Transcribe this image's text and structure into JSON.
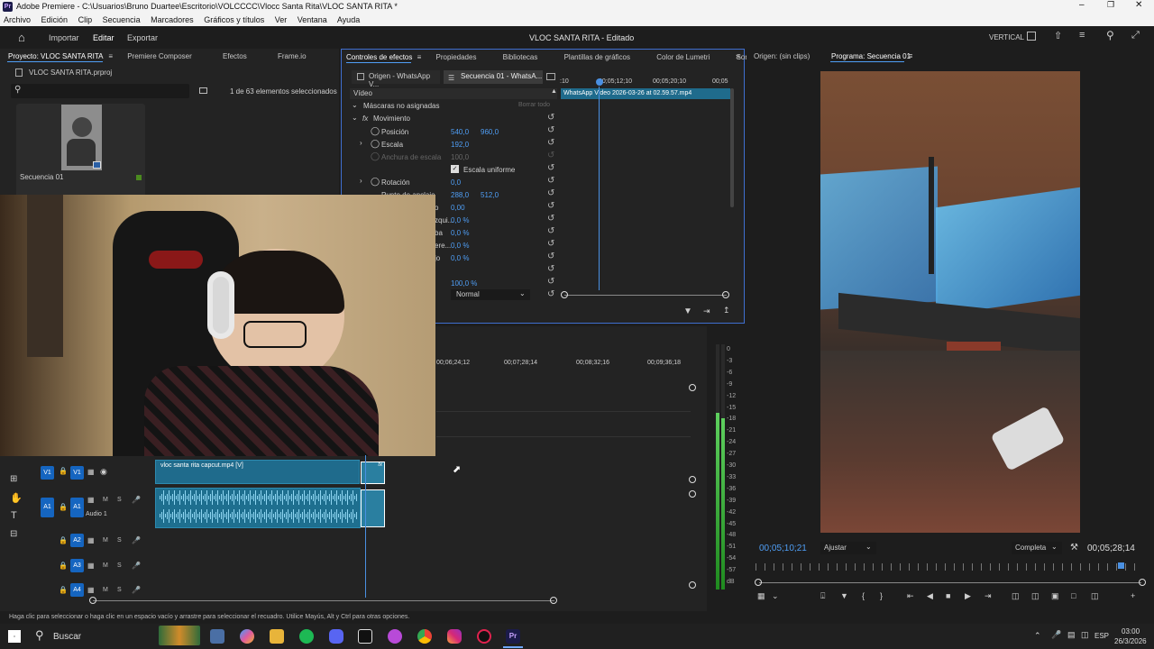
{
  "window": {
    "title": "Adobe Premiere - C:\\Usuarios\\Bruno Duartee\\Escritorio\\VOLCCCC\\Vlocc Santa Rita\\VLOC SANTA RITA *",
    "app_icon": "Pr"
  },
  "menu": [
    "Archivo",
    "Edición",
    "Clip",
    "Secuencia",
    "Marcadores",
    "Gráficos y títulos",
    "Ver",
    "Ventana",
    "Ayuda"
  ],
  "appbar": {
    "tabs": [
      "Importar",
      "Editar",
      "Exportar"
    ],
    "center_title": "VLOC SANTA RITA - Editado",
    "layout_label": "VERTICAL"
  },
  "project": {
    "tabs": [
      "Proyecto: VLOC SANTA RITA",
      "Premiere Composer",
      "Efectos",
      "Frame.io"
    ],
    "file": "VLOC SANTA RITA.prproj",
    "selection_count": "1 de 63 elementos seleccionados",
    "item_name": "Secuencia 01"
  },
  "effect_controls": {
    "tabs": [
      "Controles de efectos",
      "Propiedades",
      "Bibliotecas",
      "Plantillas de gráficos",
      "Color de Lumetri",
      "Sonido e"
    ],
    "source_tab": "Origen - WhatsApp V...",
    "sequence_tab": "Secuencia 01 - WhatsA...",
    "section_video": "Vídeo",
    "masks": "Máscaras no asignadas",
    "clear_all": "Borrar todo",
    "motion": "Movimiento",
    "position_label": "Posición",
    "position_x": "540,0",
    "position_y": "960,0",
    "scale_label": "Escala",
    "scale_value": "192,0",
    "scale_width_label": "Anchura de escala",
    "scale_width_value": "100,0",
    "uniform_scale": "Escala uniforme",
    "rotation_label": "Rotación",
    "rotation_value": "0,0",
    "anchor_label": "Punto de anclaje",
    "anchor_x": "288,0",
    "anchor_y": "512,0",
    "extra_values": [
      "0,00",
      "0,0 %",
      "0,0 %",
      "0,0 %",
      "0,0 %"
    ],
    "extra_labels": [
      "o",
      "zqui...",
      "ba",
      "ere...",
      "jo"
    ],
    "opacity_value": "100,0 %",
    "blend_mode": "Normal",
    "ruler_times": [
      ":10",
      "00;05;12;10",
      "00;05;20;10",
      "00;05"
    ],
    "clip_name": "WhatsApp Video 2026-03-26 at 02.59.57.mp4"
  },
  "program": {
    "source_tab": "Origen: (sin clips)",
    "program_tab": "Programa: Secuencia 01",
    "current_time": "00;05;10;21",
    "fit": "Ajustar",
    "quality": "Completa",
    "duration": "00;05;28;14"
  },
  "timeline": {
    "ruler_times": [
      "00;06;24;12",
      "00;07;28;14",
      "00;08;32;16",
      "00;09;36;18"
    ],
    "video_clip": "vloc santa rita capcut.mp4 [V]",
    "tracks": [
      {
        "target": "V1",
        "name": "V1"
      },
      {
        "target": "A1",
        "name": "A1",
        "label": "Audio 1"
      },
      {
        "target": "",
        "name": "A2"
      },
      {
        "target": "",
        "name": "A3"
      },
      {
        "target": "",
        "name": "A4"
      }
    ],
    "track_buttons": [
      "M",
      "S"
    ]
  },
  "audio_meter": {
    "labels": [
      "0",
      "-3",
      "-6",
      "-9",
      "-12",
      "-15",
      "-18",
      "-21",
      "-24",
      "-27",
      "-30",
      "-33",
      "-36",
      "-39",
      "-42",
      "-45",
      "-48",
      "-51",
      "-54",
      "-57",
      "dB"
    ],
    "level_fraction": 0.72
  },
  "status": "Haga clic para seleccionar o haga clic en un espacio vacío y arrastre para seleccionar el recuadro. Utilice Mayús, Alt y Ctrl para otras opciones.",
  "taskbar": {
    "search": "Buscar",
    "lang": "ESP",
    "time": "03:00",
    "date": "26/3/2026"
  },
  "colors": {
    "accent_blue": "#4f9ef5",
    "clip_video": "#1f6b8c",
    "clip_audio": "#1e6f8f",
    "track_target": "#1565c0",
    "playhead": "#4a90e2"
  }
}
